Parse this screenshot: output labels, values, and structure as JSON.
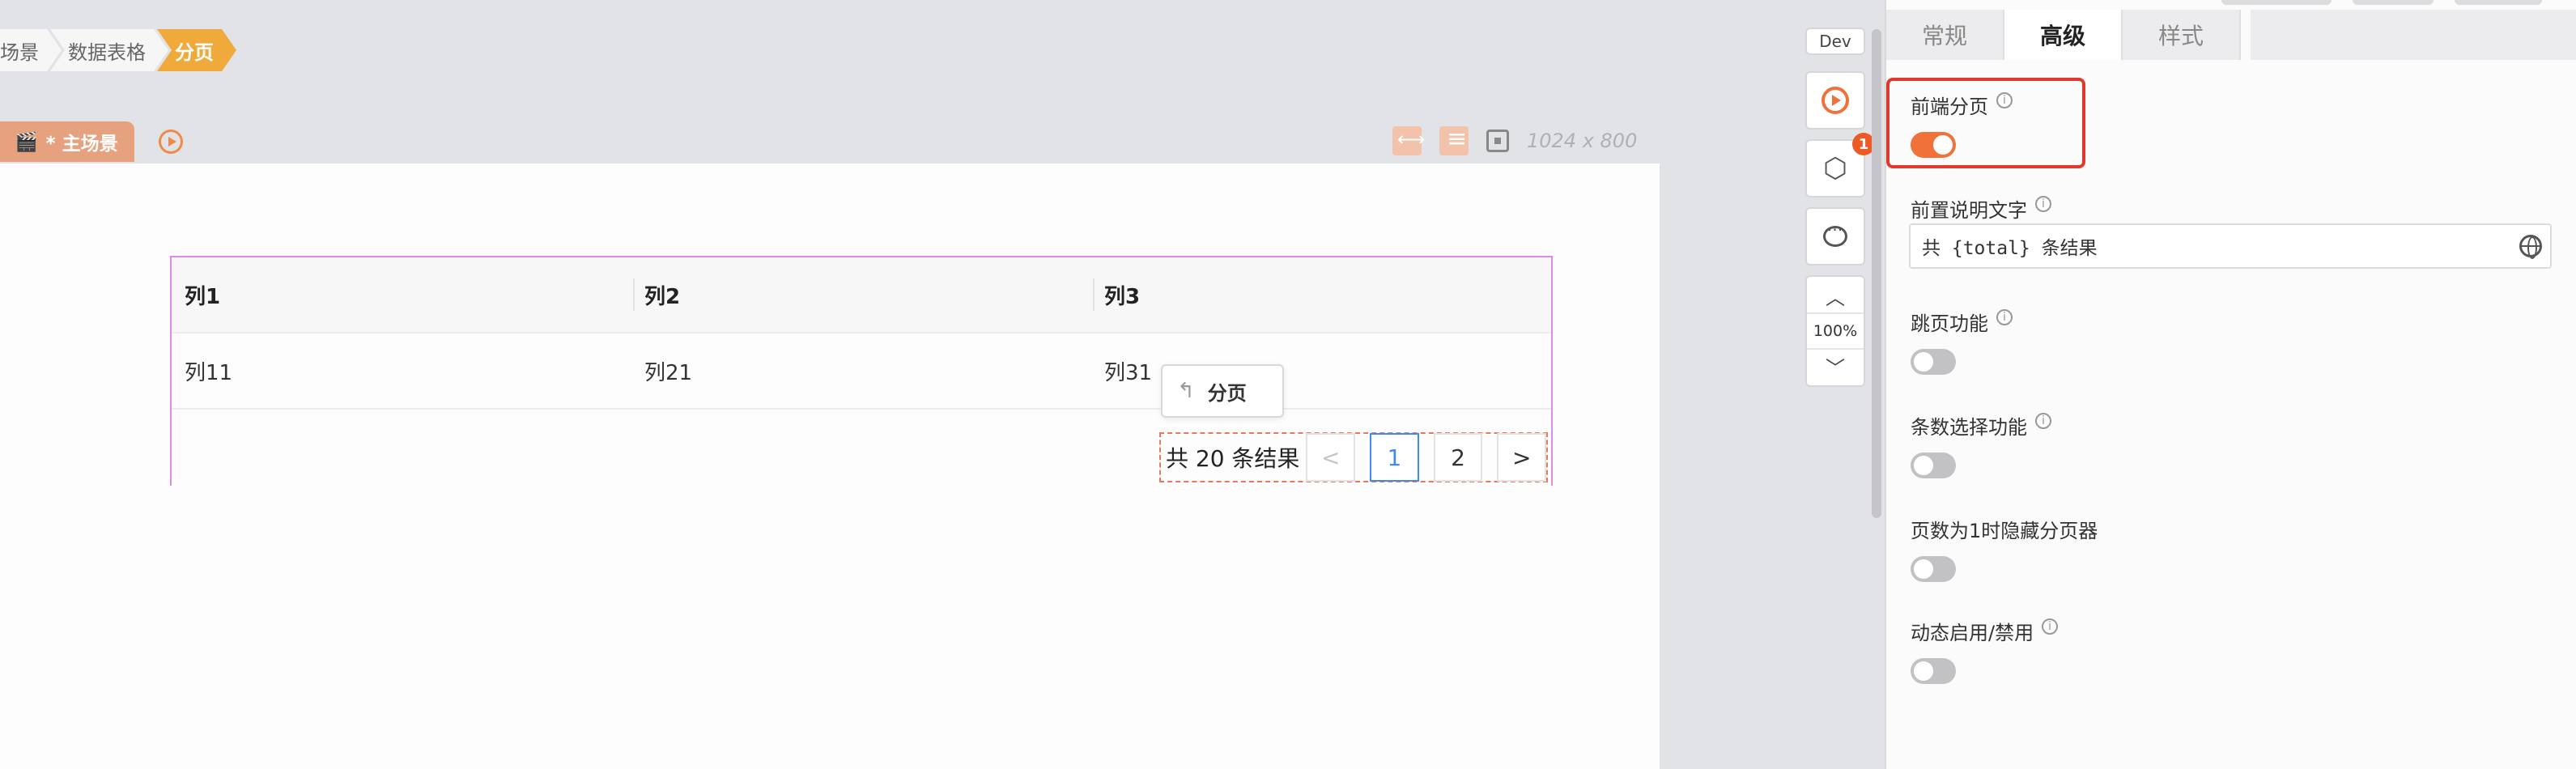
{
  "breadcrumb": [
    "场景",
    "数据表格",
    "分页"
  ],
  "scene": {
    "tab_label": "* 主场景",
    "resolution": "1024 x 800"
  },
  "table": {
    "columns": [
      "列1",
      "列2",
      "列3"
    ],
    "rows": [
      [
        "列11",
        "列21",
        "列31"
      ]
    ]
  },
  "floating_tag": {
    "label": "分页"
  },
  "pagination": {
    "total_text": "共 20 条结果",
    "prev": "<",
    "pages": [
      "1",
      "2"
    ],
    "current_page": "1",
    "next": ">"
  },
  "toolbar": {
    "env": "Dev",
    "badge_count": "1",
    "zoom": "100%"
  },
  "panel": {
    "tabs": [
      "常规",
      "高级",
      "样式"
    ],
    "active_tab": "高级",
    "settings": [
      {
        "label": "前端分页",
        "enabled": true
      },
      {
        "label": "前置说明文字",
        "value": "共 {total} 条结果"
      },
      {
        "label": "跳页功能",
        "enabled": false
      },
      {
        "label": "条数选择功能",
        "enabled": false
      },
      {
        "label": "页数为1时隐藏分页器",
        "enabled": false
      },
      {
        "label": "动态启用/禁用",
        "enabled": false
      }
    ]
  },
  "colors": {
    "accent": "#f0713a",
    "breadcrumb_active": "#f0a93b",
    "highlight": "#e03a2f",
    "link": "#3f8bf3"
  }
}
